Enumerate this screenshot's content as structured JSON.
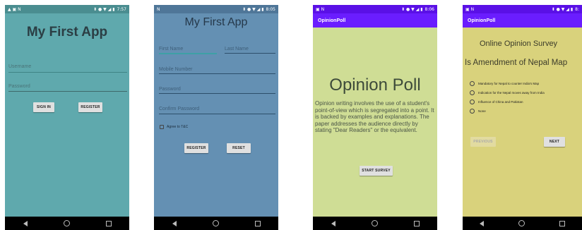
{
  "status_bar": {
    "left_icons_1": "▲ ▣ N",
    "left_icons": "N",
    "left_icons_3": "▣ N",
    "right_icons": "⬍ ● ▼ ◢ ▮",
    "time_1": "7:57",
    "time_2": "8:05",
    "time_3": "8:06",
    "time_4": "8:"
  },
  "screen1": {
    "bg": "#5fa9ad",
    "title": "My First App",
    "username_placeholder": "Username",
    "password_placeholder": "Password",
    "sign_in": "SIGN IN",
    "register": "REGISTER"
  },
  "screen2": {
    "bg": "#6490b3",
    "title": "My First App",
    "first_name": "First Name",
    "last_name": "Last Name",
    "mobile": "Mobile Number",
    "password": "Password",
    "confirm_password": "Confirm Password",
    "agree": "Agree to T&C",
    "register": "REGISTER",
    "reset": "RESET"
  },
  "screen3": {
    "bg": "#cfdd95",
    "appbar_title": "OpinionPoll",
    "appbar_color": "#6a1dff",
    "heading": "Opinion Poll",
    "body": "Opinion writing involves the use of a student's point-of-view which is segregated into a point. It is backed by examples and explanations. The paper addresses the audience directly by stating \"Dear Readers\" or the equivalent.",
    "start_survey": "START SURVEY"
  },
  "screen4": {
    "bg": "#d9d27c",
    "appbar_title": "OpinionPoll",
    "survey_title": "Online Opinion Survey",
    "question": "Is Amendment of Nepal Map",
    "options": [
      "Mandatory for Nepal to counter India's Map",
      "Indication for the Nepal moves away from India",
      "Influence of China and Pakistan",
      "None"
    ],
    "previous": "PREVIOUS",
    "next": "NEXT"
  },
  "icons": [
    "back-icon",
    "home-icon",
    "recents-icon",
    "wifi-icon",
    "battery-icon"
  ]
}
